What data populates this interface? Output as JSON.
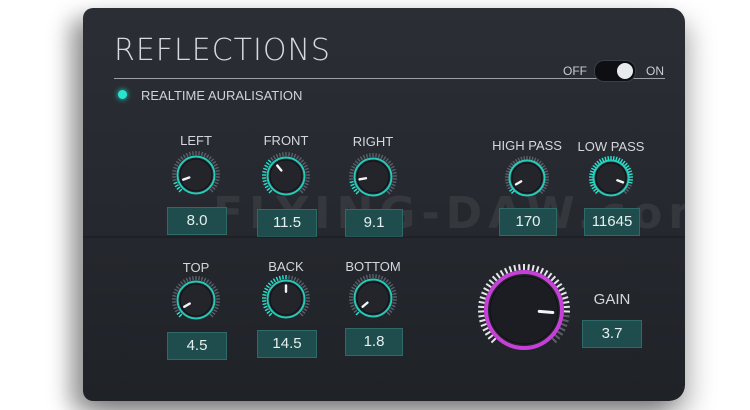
{
  "title": "REFLECTIONS",
  "power_toggle": {
    "off_label": "OFF",
    "on_label": "ON",
    "state": "on"
  },
  "auralisation": {
    "label": "REALTIME AURALISATION",
    "active": true
  },
  "knobs": {
    "left": {
      "label": "LEFT",
      "value": "8.0"
    },
    "front": {
      "label": "FRONT",
      "value": "11.5"
    },
    "right": {
      "label": "RIGHT",
      "value": "9.1"
    },
    "high_pass": {
      "label": "HIGH PASS",
      "value": "170"
    },
    "low_pass": {
      "label": "LOW PASS",
      "value": "11645"
    },
    "top": {
      "label": "TOP",
      "value": "4.5"
    },
    "back": {
      "label": "BACK",
      "value": "14.5"
    },
    "bottom": {
      "label": "BOTTOM",
      "value": "1.8"
    },
    "gain": {
      "label": "GAIN",
      "value": "3.7"
    }
  },
  "watermark": "FLYING-DAW.com",
  "colors": {
    "panel": "#262a30",
    "accent_teal": "#27e6d0",
    "gain_ring": "#c640d8",
    "value_box": "#1f4d4d",
    "text": "#d4d7dc"
  }
}
